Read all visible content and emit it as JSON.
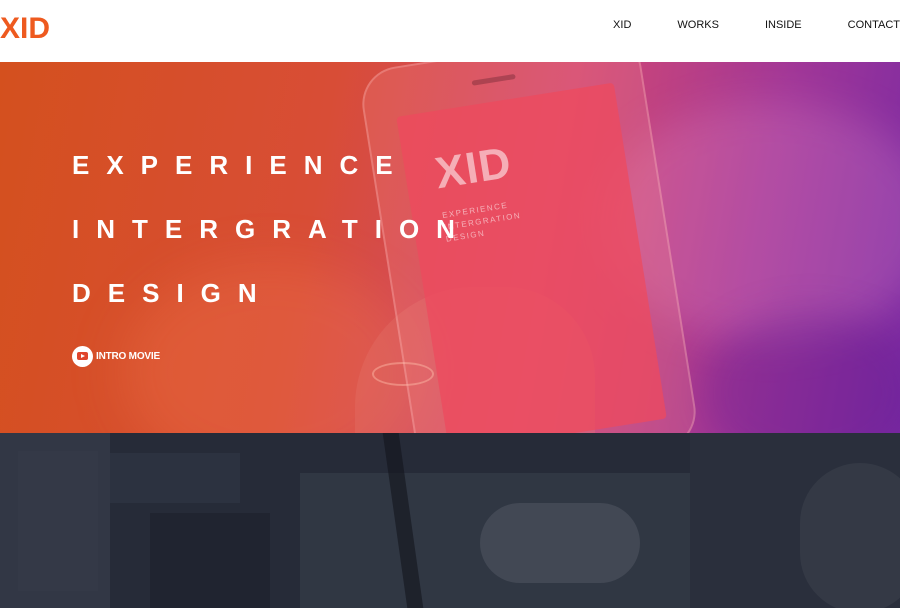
{
  "header": {
    "logo": "XID",
    "nav": [
      "XID",
      "WORKS",
      "INSIDE",
      "CONTACT"
    ]
  },
  "hero": {
    "headline": [
      "EXPERIENCE",
      "INTERGRATION",
      "DESIGN"
    ],
    "intro_label": "INTRO MOVIE",
    "phone_screen": {
      "logo": "XID",
      "lines": [
        "EXPERIENCE",
        "INTERGRATION",
        "DESIGN"
      ]
    }
  },
  "colors": {
    "brand": "#ee5a1f",
    "hero_gradient": [
      "#d4501e",
      "#d84d36",
      "#d24873",
      "#a23797",
      "#7b2aa3"
    ],
    "dark_section": "#262b38"
  },
  "icons": {
    "intro": "youtube-play-icon"
  }
}
